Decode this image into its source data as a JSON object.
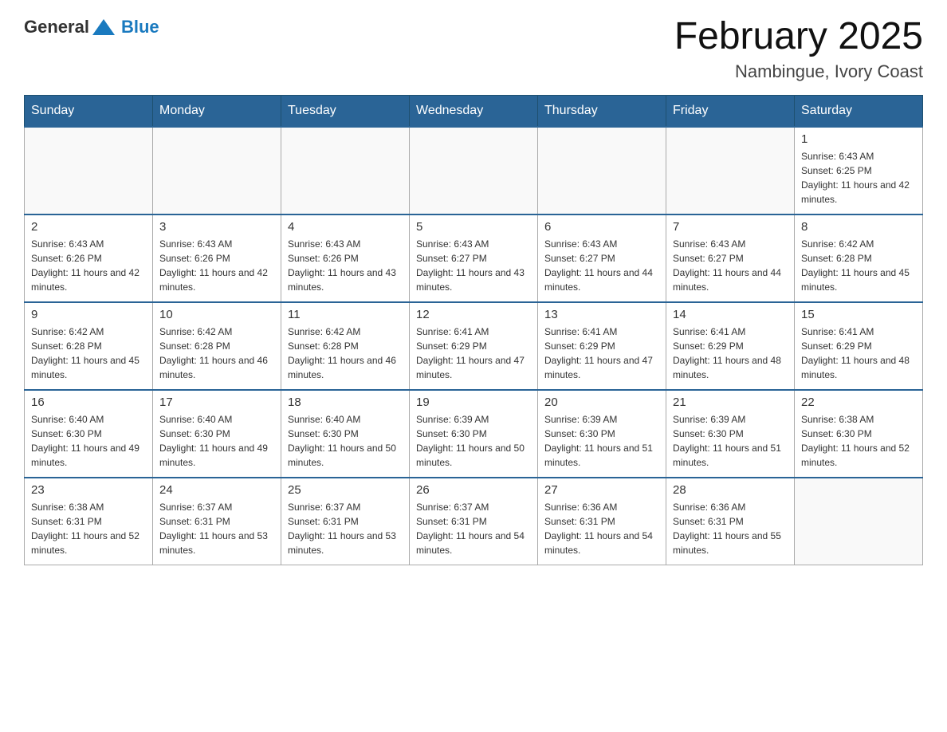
{
  "header": {
    "logo_general": "General",
    "logo_blue": "Blue",
    "month_title": "February 2025",
    "location": "Nambingue, Ivory Coast"
  },
  "days_of_week": [
    "Sunday",
    "Monday",
    "Tuesday",
    "Wednesday",
    "Thursday",
    "Friday",
    "Saturday"
  ],
  "weeks": [
    [
      {
        "day": "",
        "info": ""
      },
      {
        "day": "",
        "info": ""
      },
      {
        "day": "",
        "info": ""
      },
      {
        "day": "",
        "info": ""
      },
      {
        "day": "",
        "info": ""
      },
      {
        "day": "",
        "info": ""
      },
      {
        "day": "1",
        "info": "Sunrise: 6:43 AM\nSunset: 6:25 PM\nDaylight: 11 hours and 42 minutes."
      }
    ],
    [
      {
        "day": "2",
        "info": "Sunrise: 6:43 AM\nSunset: 6:26 PM\nDaylight: 11 hours and 42 minutes."
      },
      {
        "day": "3",
        "info": "Sunrise: 6:43 AM\nSunset: 6:26 PM\nDaylight: 11 hours and 42 minutes."
      },
      {
        "day": "4",
        "info": "Sunrise: 6:43 AM\nSunset: 6:26 PM\nDaylight: 11 hours and 43 minutes."
      },
      {
        "day": "5",
        "info": "Sunrise: 6:43 AM\nSunset: 6:27 PM\nDaylight: 11 hours and 43 minutes."
      },
      {
        "day": "6",
        "info": "Sunrise: 6:43 AM\nSunset: 6:27 PM\nDaylight: 11 hours and 44 minutes."
      },
      {
        "day": "7",
        "info": "Sunrise: 6:43 AM\nSunset: 6:27 PM\nDaylight: 11 hours and 44 minutes."
      },
      {
        "day": "8",
        "info": "Sunrise: 6:42 AM\nSunset: 6:28 PM\nDaylight: 11 hours and 45 minutes."
      }
    ],
    [
      {
        "day": "9",
        "info": "Sunrise: 6:42 AM\nSunset: 6:28 PM\nDaylight: 11 hours and 45 minutes."
      },
      {
        "day": "10",
        "info": "Sunrise: 6:42 AM\nSunset: 6:28 PM\nDaylight: 11 hours and 46 minutes."
      },
      {
        "day": "11",
        "info": "Sunrise: 6:42 AM\nSunset: 6:28 PM\nDaylight: 11 hours and 46 minutes."
      },
      {
        "day": "12",
        "info": "Sunrise: 6:41 AM\nSunset: 6:29 PM\nDaylight: 11 hours and 47 minutes."
      },
      {
        "day": "13",
        "info": "Sunrise: 6:41 AM\nSunset: 6:29 PM\nDaylight: 11 hours and 47 minutes."
      },
      {
        "day": "14",
        "info": "Sunrise: 6:41 AM\nSunset: 6:29 PM\nDaylight: 11 hours and 48 minutes."
      },
      {
        "day": "15",
        "info": "Sunrise: 6:41 AM\nSunset: 6:29 PM\nDaylight: 11 hours and 48 minutes."
      }
    ],
    [
      {
        "day": "16",
        "info": "Sunrise: 6:40 AM\nSunset: 6:30 PM\nDaylight: 11 hours and 49 minutes."
      },
      {
        "day": "17",
        "info": "Sunrise: 6:40 AM\nSunset: 6:30 PM\nDaylight: 11 hours and 49 minutes."
      },
      {
        "day": "18",
        "info": "Sunrise: 6:40 AM\nSunset: 6:30 PM\nDaylight: 11 hours and 50 minutes."
      },
      {
        "day": "19",
        "info": "Sunrise: 6:39 AM\nSunset: 6:30 PM\nDaylight: 11 hours and 50 minutes."
      },
      {
        "day": "20",
        "info": "Sunrise: 6:39 AM\nSunset: 6:30 PM\nDaylight: 11 hours and 51 minutes."
      },
      {
        "day": "21",
        "info": "Sunrise: 6:39 AM\nSunset: 6:30 PM\nDaylight: 11 hours and 51 minutes."
      },
      {
        "day": "22",
        "info": "Sunrise: 6:38 AM\nSunset: 6:30 PM\nDaylight: 11 hours and 52 minutes."
      }
    ],
    [
      {
        "day": "23",
        "info": "Sunrise: 6:38 AM\nSunset: 6:31 PM\nDaylight: 11 hours and 52 minutes."
      },
      {
        "day": "24",
        "info": "Sunrise: 6:37 AM\nSunset: 6:31 PM\nDaylight: 11 hours and 53 minutes."
      },
      {
        "day": "25",
        "info": "Sunrise: 6:37 AM\nSunset: 6:31 PM\nDaylight: 11 hours and 53 minutes."
      },
      {
        "day": "26",
        "info": "Sunrise: 6:37 AM\nSunset: 6:31 PM\nDaylight: 11 hours and 54 minutes."
      },
      {
        "day": "27",
        "info": "Sunrise: 6:36 AM\nSunset: 6:31 PM\nDaylight: 11 hours and 54 minutes."
      },
      {
        "day": "28",
        "info": "Sunrise: 6:36 AM\nSunset: 6:31 PM\nDaylight: 11 hours and 55 minutes."
      },
      {
        "day": "",
        "info": ""
      }
    ]
  ]
}
